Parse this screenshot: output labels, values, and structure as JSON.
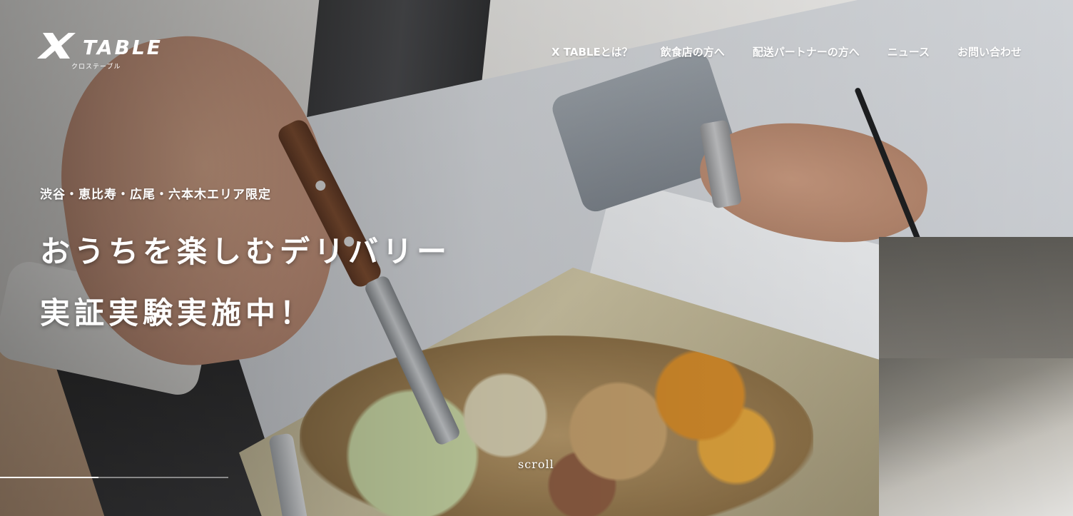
{
  "brand": {
    "logo_text": "TABLE",
    "logo_subtext": "クロステーブル"
  },
  "nav": {
    "items": [
      {
        "label": "X TABLEとは？"
      },
      {
        "label": "飲食店の方へ"
      },
      {
        "label": "配送パートナーの方へ"
      },
      {
        "label": "ニュース"
      },
      {
        "label": "お問い合わせ"
      }
    ]
  },
  "hero": {
    "eyebrow": "渋谷・恵比寿・広尾・六本木エリア限定",
    "headline_line1": "おうちを楽しむデリバリー",
    "headline_line2": "実証実験実施中！",
    "background_image": "photo-salad-delivery-box"
  },
  "scroll": {
    "label": "scroll",
    "progress": 0.43
  },
  "colors": {
    "text": "#ffffff",
    "overlay": "#000000"
  }
}
